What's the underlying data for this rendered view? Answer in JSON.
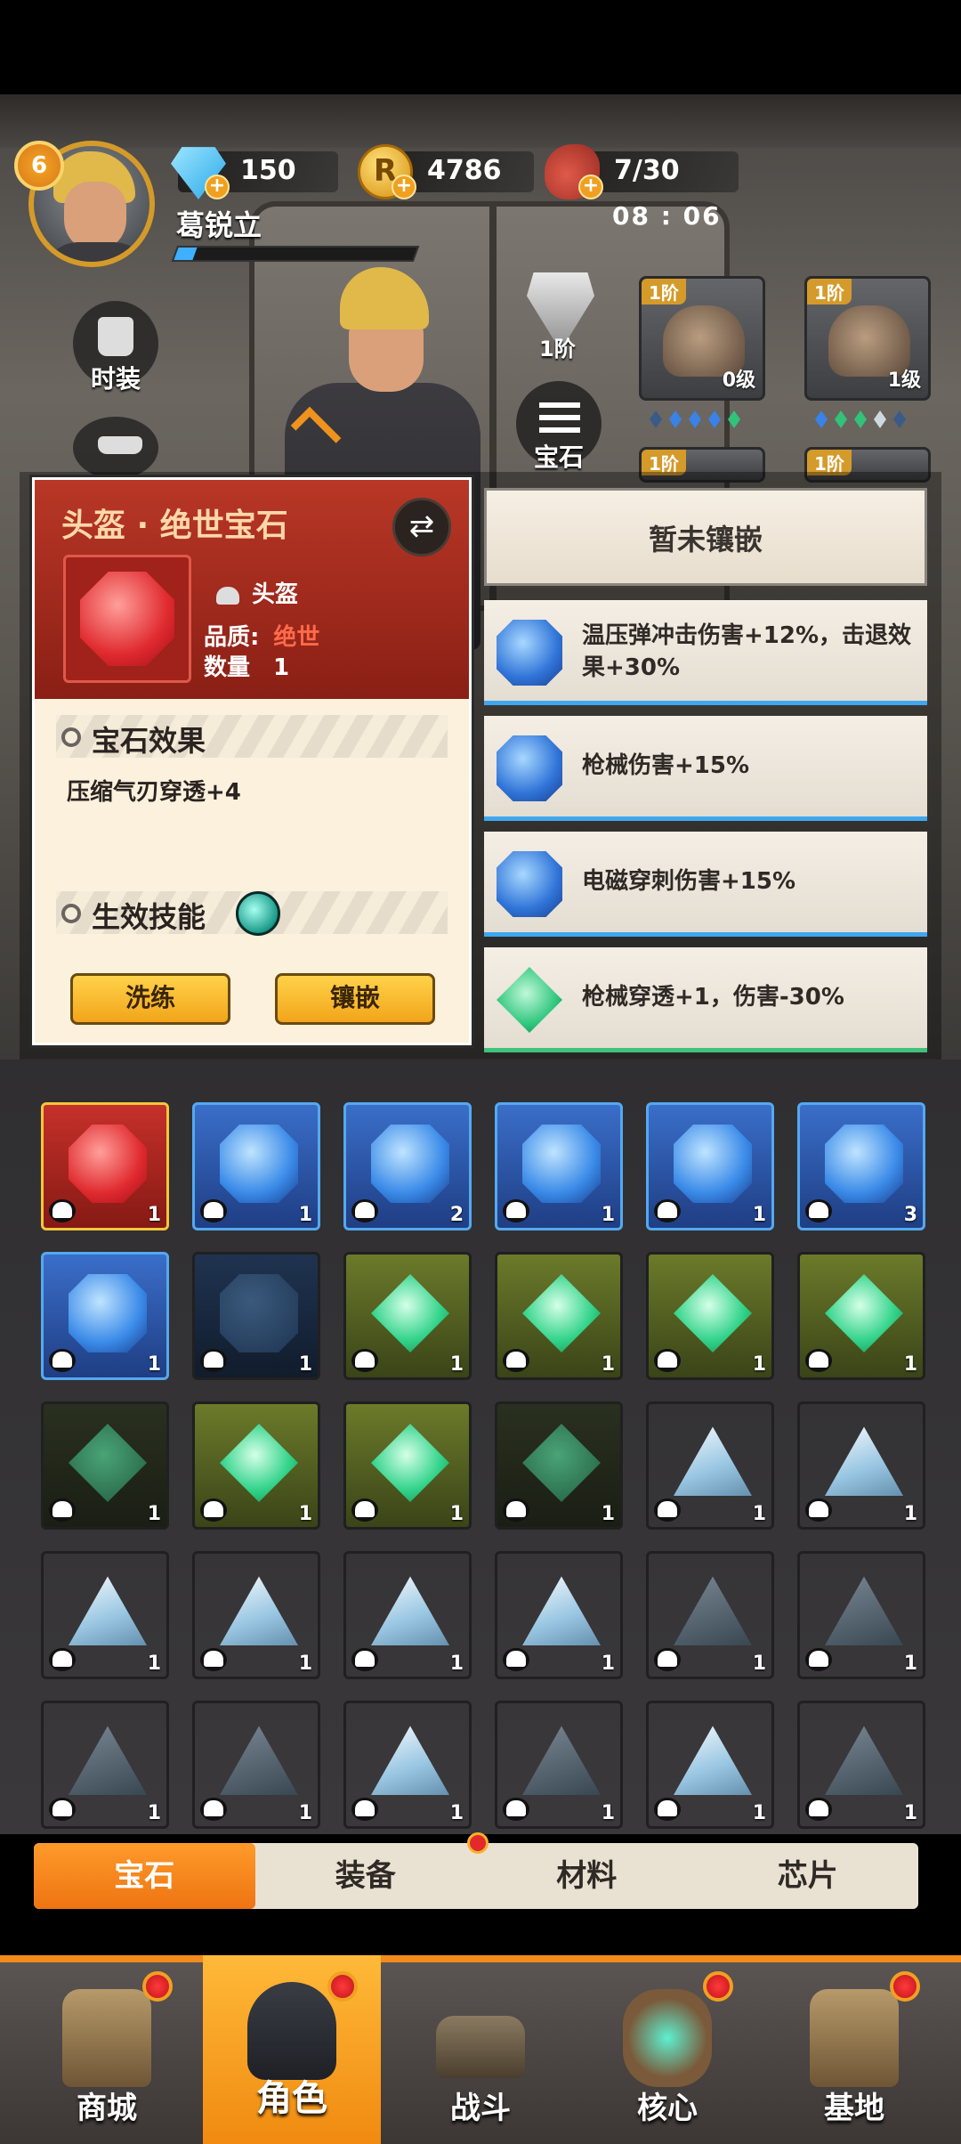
{
  "player": {
    "level": "6",
    "name": "葛锐立",
    "xp_fraction": 0.08
  },
  "resources": {
    "diamonds": "150",
    "coins": "4786",
    "coin_symbol": "R",
    "stamina": "7/30",
    "timer": "08 : 06"
  },
  "side_buttons": {
    "fashion_label": "时装",
    "gem_label": "宝石",
    "tier_label": "1阶"
  },
  "equipment": [
    {
      "tier": "1阶",
      "level": "0级"
    },
    {
      "tier": "1阶",
      "level": "1级"
    },
    {
      "tier": "1阶",
      "level": ""
    },
    {
      "tier": "1阶",
      "level": ""
    }
  ],
  "detail_card": {
    "title": "头盔 · 绝世宝石",
    "slot": "头盔",
    "quality_label": "品质:",
    "quality_value": "绝世",
    "count_label": "数量",
    "count_value": "1",
    "effect_header": "宝石效果",
    "effect_text": "压缩气刃穿透+4",
    "skill_header": "生效技能",
    "reforge_button": "洗练",
    "inlay_button": "镶嵌",
    "quality_color": "#ff6a4a"
  },
  "socket_panel": {
    "empty_text": "暂未镶嵌",
    "options": [
      {
        "gem": "blue",
        "text": "温压弹冲击伤害+12%，击退效果+30%"
      },
      {
        "gem": "blue",
        "text": "枪械伤害+15%"
      },
      {
        "gem": "blue",
        "text": "电磁穿刺伤害+15%"
      },
      {
        "gem": "green",
        "text": "枪械穿透+1，伤害-30%"
      }
    ]
  },
  "gem_grid": [
    [
      {
        "type": "red",
        "count": "1"
      },
      {
        "type": "blue",
        "count": "1"
      },
      {
        "type": "blue",
        "count": "2"
      },
      {
        "type": "blue",
        "count": "1"
      },
      {
        "type": "blue",
        "count": "1"
      },
      {
        "type": "blue",
        "count": "3"
      }
    ],
    [
      {
        "type": "blue",
        "count": "1"
      },
      {
        "type": "bluedim",
        "count": "1"
      },
      {
        "type": "green",
        "count": "1"
      },
      {
        "type": "green",
        "count": "1"
      },
      {
        "type": "green",
        "count": "1"
      },
      {
        "type": "green",
        "count": "1"
      }
    ],
    [
      {
        "type": "greendim",
        "count": "1"
      },
      {
        "type": "green",
        "count": "1"
      },
      {
        "type": "green",
        "count": "1"
      },
      {
        "type": "greendim",
        "count": "1"
      },
      {
        "type": "tri",
        "count": "1"
      },
      {
        "type": "tri",
        "count": "1"
      }
    ],
    [
      {
        "type": "tri",
        "count": "1"
      },
      {
        "type": "tri",
        "count": "1"
      },
      {
        "type": "tri",
        "count": "1"
      },
      {
        "type": "tri",
        "count": "1"
      },
      {
        "type": "tridim",
        "count": "1"
      },
      {
        "type": "tridim",
        "count": "1"
      }
    ],
    [
      {
        "type": "tridim",
        "count": "1"
      },
      {
        "type": "tridim",
        "count": "1"
      },
      {
        "type": "tri",
        "count": "1"
      },
      {
        "type": "tridim",
        "count": "1"
      },
      {
        "type": "tri",
        "count": "1"
      },
      {
        "type": "tridim",
        "count": "1"
      }
    ]
  ],
  "tabs": [
    "宝石",
    "装备",
    "材料",
    "芯片"
  ],
  "nav": [
    "商城",
    "角色",
    "战斗",
    "核心",
    "基地"
  ]
}
